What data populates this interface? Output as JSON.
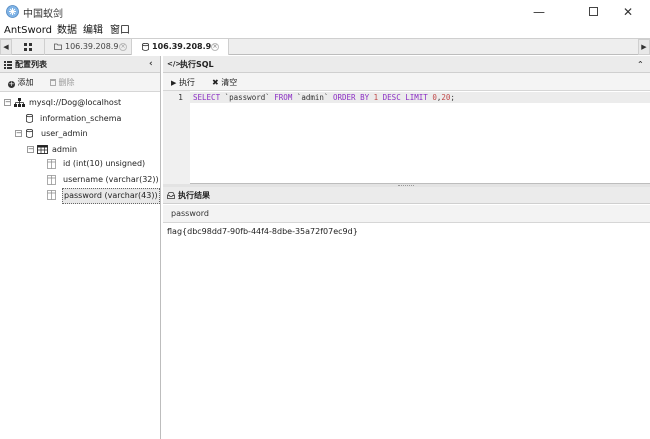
{
  "window": {
    "title": "中国蚁剑"
  },
  "menu": {
    "items": [
      "AntSword",
      "数据",
      "编辑",
      "窗口"
    ]
  },
  "tabs": {
    "home_icon": "grid-icon",
    "items": [
      {
        "label": "106.39.208.9",
        "active": false
      },
      {
        "label": "106.39.208.9",
        "active": true
      }
    ]
  },
  "left": {
    "header": "配置列表",
    "add_label": "添加",
    "delete_label": "删除",
    "tree": {
      "connection": "mysql://Dog@localhost",
      "db1": "information_schema",
      "db2": "user_admin",
      "table": "admin",
      "columns": [
        "id (int(10) unsigned)",
        "username (varchar(32))",
        "password (varchar(43))"
      ]
    }
  },
  "sql": {
    "header": "执行SQL",
    "execute_label": "执行",
    "clear_label": "清空",
    "line_number": "1",
    "tokens": [
      {
        "t": "SELECT",
        "c": "kw"
      },
      {
        "t": " `password` ",
        "c": "str"
      },
      {
        "t": "FROM",
        "c": "kw"
      },
      {
        "t": " `admin` ",
        "c": "str"
      },
      {
        "t": "ORDER BY",
        "c": "kw"
      },
      {
        "t": " ",
        "c": "plain"
      },
      {
        "t": "1",
        "c": "num"
      },
      {
        "t": " ",
        "c": "plain"
      },
      {
        "t": "DESC LIMIT",
        "c": "kw"
      },
      {
        "t": " ",
        "c": "plain"
      },
      {
        "t": "0",
        "c": "num"
      },
      {
        "t": ",",
        "c": "plain"
      },
      {
        "t": "20",
        "c": "num"
      },
      {
        "t": ";",
        "c": "plain"
      }
    ]
  },
  "result": {
    "header": "执行结果",
    "column": "password",
    "value": "flag{dbc98dd7-90fb-44f4-8dbe-35a72f07ec9d}"
  },
  "colors": {
    "accent": "#8b2ec4",
    "number": "#c04a4a",
    "header_bg": "#ebebeb"
  }
}
